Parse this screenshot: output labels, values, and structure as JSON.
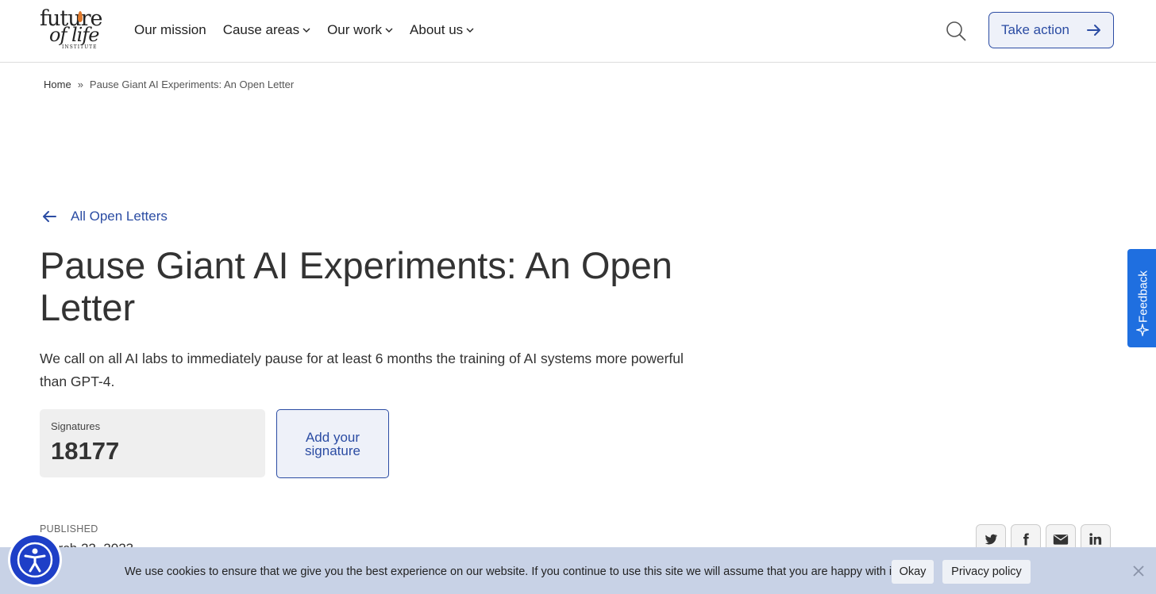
{
  "header": {
    "logo": {
      "line1": "future",
      "line2": "of life",
      "line3": "INSTITUTE"
    },
    "nav": [
      {
        "label": "Our mission",
        "has_dropdown": false
      },
      {
        "label": "Cause areas",
        "has_dropdown": true
      },
      {
        "label": "Our work",
        "has_dropdown": true
      },
      {
        "label": "About us",
        "has_dropdown": true
      }
    ],
    "search_icon": "search-icon",
    "cta_label": "Take action"
  },
  "breadcrumb": {
    "home": "Home",
    "separator": "»",
    "current": "Pause Giant AI Experiments: An Open Letter"
  },
  "article": {
    "back_label": "All Open Letters",
    "title": "Pause Giant AI Experiments: An Open Letter",
    "lede": "We call on all AI labs to immediately pause for at least 6 months the training of AI systems more powerful than GPT-4.",
    "signatures_label": "Signatures",
    "signatures_count": "18177",
    "add_signature_label": "Add your signature",
    "published_label": "PUBLISHED",
    "published_date": "March 22, 2023"
  },
  "share": [
    "twitter-icon",
    "facebook-icon",
    "email-icon",
    "linkedin-icon"
  ],
  "feedback": {
    "label": "Feedback"
  },
  "cookie": {
    "text": "We use cookies to ensure that we give you the best experience on our website. If you continue to use this site we will assume that you are happy with it.",
    "ok_label": "Okay",
    "privacy_label": "Privacy policy"
  },
  "colors": {
    "accent": "#2b4ca3",
    "feedback": "#1f6fe0",
    "cookie_bg": "#c8d2e6",
    "a11y": "#1e3fc7"
  }
}
